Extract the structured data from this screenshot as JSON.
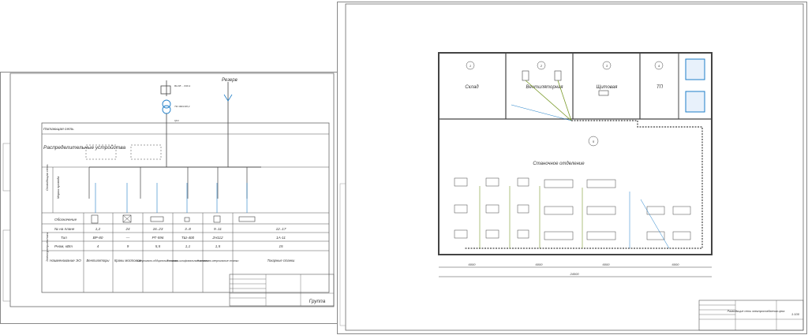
{
  "left_sheet": {
    "reserve_label": "Резерв",
    "row_labels": {
      "supply": "Питающая сеть",
      "distribution": "Распределительные устройства",
      "wiring": "Марки провода",
      "wiring_group": "Отводящая сеть",
      "consumers": "Электроприемники",
      "designation": "Обозначение",
      "plan_no": "№ на плане",
      "type": "Тип",
      "power": "Рном, кВт",
      "name": "Наименование ЭО"
    },
    "columns": [
      {
        "plan_no": "1,2",
        "type": "ВР-80",
        "power": "4",
        "name": "Вентиляторы"
      },
      {
        "plan_no": "24",
        "type": "—",
        "power": "9",
        "name": "Краны мостовые"
      },
      {
        "plan_no": "16..23",
        "type": "РТ-596",
        "power": "5,5",
        "name": "Сверлильно-обдирочные станки"
      },
      {
        "plan_no": "3..8",
        "type": "ТШ-400",
        "power": "1,1",
        "name": "Точильно-шлифовальные станки"
      },
      {
        "plan_no": "9..11",
        "type": "2Н112",
        "power": "1,5",
        "name": "Настольно-сверлильные станки"
      },
      {
        "plan_no": "12..17",
        "type": "1А-11",
        "power": "15",
        "name": "Токарные станки"
      }
    ],
    "stamp_title": "Группа"
  },
  "right_sheet": {
    "rooms": [
      {
        "number": "1",
        "area": "",
        "name": "Склад"
      },
      {
        "number": "2",
        "area": "",
        "name": "Вентиляторная"
      },
      {
        "number": "3",
        "area": "",
        "name": "Щитовая"
      },
      {
        "number": "4",
        "area": "",
        "name": "ТП"
      }
    ],
    "hall_number": "5",
    "hall_name": "Станочное отделение",
    "dimensions": {
      "bays": [
        "6000",
        "6000",
        "6000",
        "6000"
      ],
      "total": "24000"
    },
    "stamp_title": "Разводящие сети электроснабжения цеха",
    "stamp_sheet": "1:100"
  },
  "colors": {
    "line": "#444444",
    "accent_blue": "#1e7ec8",
    "accent_green": "#7a9a2a"
  }
}
